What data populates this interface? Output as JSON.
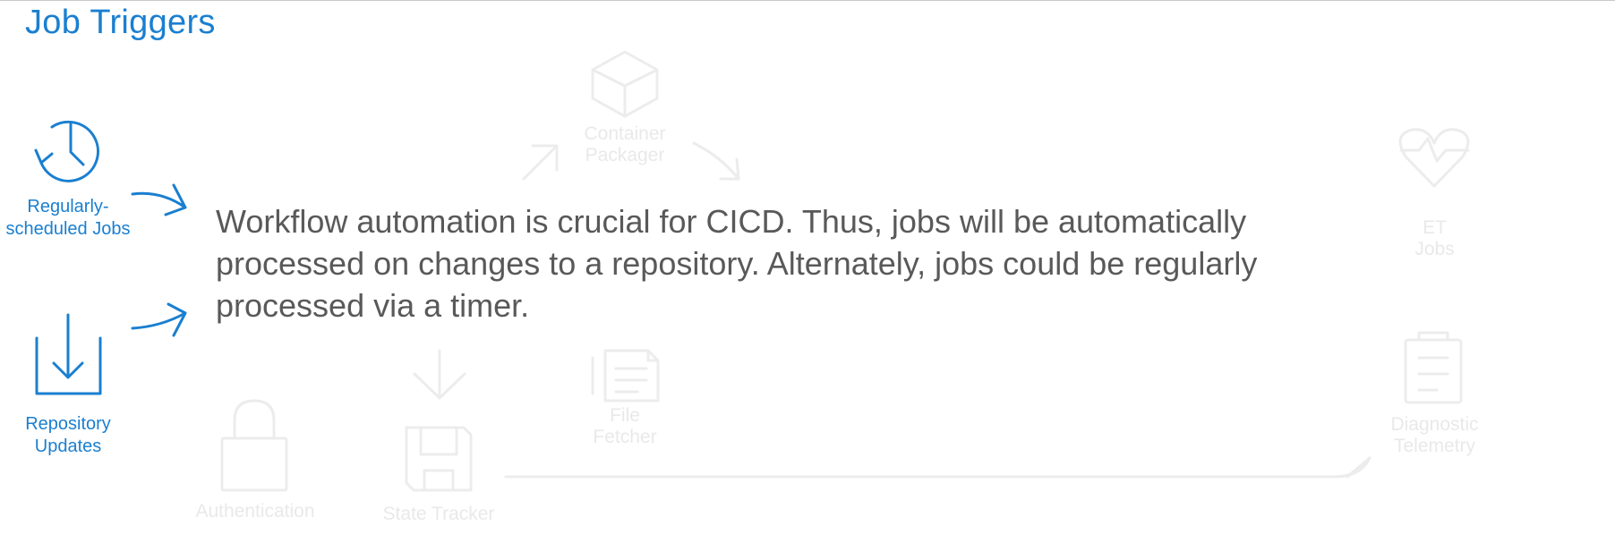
{
  "slide": {
    "title": "Job Triggers",
    "description": "Workflow automation is crucial for CICD. Thus, jobs will be automatically processed on changes to a repository. Alternately, jobs could be regularly processed via a timer."
  },
  "triggers": [
    {
      "label_line1": "Regularly-",
      "label_line2": "scheduled Jobs",
      "icon": "clock-icon"
    },
    {
      "label_line1": "Repository",
      "label_line2": "Updates",
      "icon": "download-icon"
    }
  ],
  "background_nodes": {
    "container_packager": {
      "line1": "Container",
      "line2": "Packager",
      "icon": "box-icon"
    },
    "file_fetcher": {
      "line1": "File",
      "line2": "Fetcher",
      "icon": "file-icon"
    },
    "authentication": {
      "line1": "Authentication",
      "icon": "lock-icon"
    },
    "state_tracker": {
      "line1": "State Tracker",
      "icon": "floppy-disk-icon"
    },
    "right_top": {
      "line1": "ET",
      "line2": "Jobs",
      "icon": "heart-icon"
    },
    "right_bottom": {
      "line1": "Diagnostic",
      "line2": "Telemetry",
      "icon": "clipboard-icon"
    }
  },
  "colors": {
    "accent": "#1a7fd0",
    "body_text": "#595959",
    "ghost": "#e9e9e9"
  }
}
